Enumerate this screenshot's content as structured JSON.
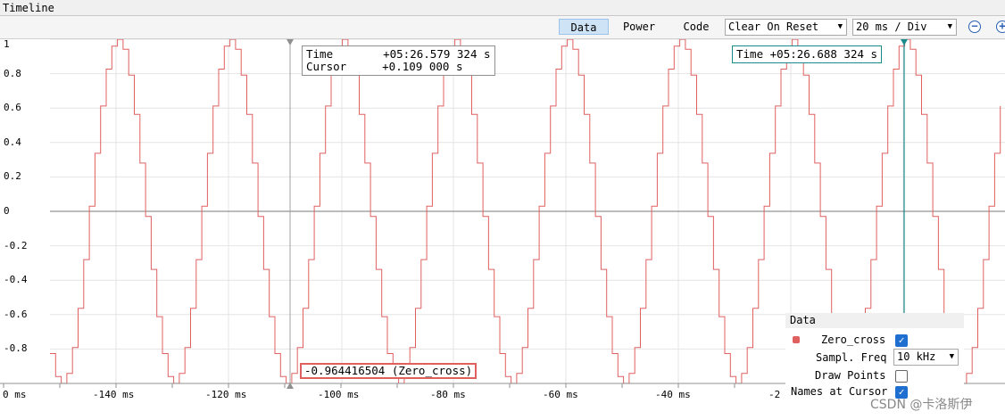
{
  "window": {
    "title": "Timeline"
  },
  "toolbar": {
    "tabs": [
      "Data",
      "Power",
      "Code"
    ],
    "active_tab": "Data",
    "reset_mode": "Clear On Reset",
    "time_div": "20 ms / Div",
    "zoom_out_icon": "minus-circle-icon",
    "zoom_in_icon": "plus-circle-icon"
  },
  "plot": {
    "y_ticks": [
      "1",
      "0.8",
      "0.6",
      "0.4",
      "0.2",
      "0",
      "-0.2",
      "-0.4",
      "-0.6",
      "-0.8"
    ],
    "x_ticks": [
      "0 ms",
      "-140 ms",
      "-120 ms",
      "-100 ms",
      "-80 ms",
      "-60 ms",
      "-40 ms",
      "-2"
    ],
    "trace_color": "#e06060",
    "cursor_color": "#1a8a8a"
  },
  "cursor_tooltip": {
    "time_label": "Time",
    "time_value": "+05:26.579 324 s",
    "cursor_label": "Cursor",
    "cursor_value": "+0.109 000 s"
  },
  "time_tooltip": {
    "label": "Time",
    "value": "+05:26.688 324 s"
  },
  "value_tooltip": {
    "text": "-0.964416504 (Zero_cross)"
  },
  "data_panel": {
    "title": "Data",
    "signal_name": "Zero_cross",
    "signal_checked": true,
    "sampl_freq_label": "Sampl. Freq",
    "sampl_freq_value": "10 kHz",
    "draw_points_label": "Draw Points",
    "draw_points_checked": false,
    "names_cursor_label": "Names at Cursor",
    "names_cursor_checked": true
  },
  "watermark": "CSDN @卡洛斯伊"
}
